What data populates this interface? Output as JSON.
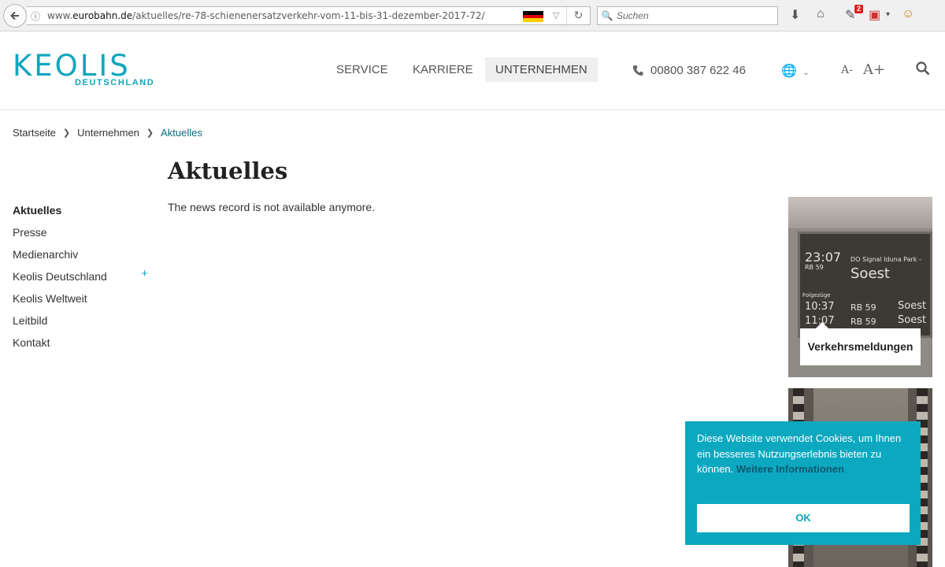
{
  "browser": {
    "url_prefix": "www.",
    "url_domain": "eurobahn.de",
    "url_path": "/aktuelles/re-78-schienenersatzverkehr-vom-11-bis-31-dezember-2017-72/",
    "search_placeholder": "Suchen",
    "notification_count": "2",
    "flag_colors": [
      "#000000",
      "#dd0000",
      "#ffce00"
    ]
  },
  "header": {
    "logo_word": "KEOLIS",
    "logo_sub": "DEUTSCHLAND",
    "nav": [
      "SERVICE",
      "KARRIERE",
      "UNTERNEHMEN"
    ],
    "phone": "00800 387 622 46",
    "font_smaller": "A-",
    "font_larger": "A+",
    "accent_color": "#0fa6bd"
  },
  "breadcrumb": [
    "Startseite",
    "Unternehmen",
    "Aktuelles"
  ],
  "main": {
    "title": "Aktuelles",
    "message": "The news record is not available anymore."
  },
  "sidebar": {
    "items": [
      "Aktuelles",
      "Presse",
      "Medienarchiv",
      "Keolis Deutschland",
      "Keolis Weltweit",
      "Leitbild",
      "Kontakt"
    ],
    "expand_symbol": "+"
  },
  "teaser": {
    "label": "Verkehrsmeldungen",
    "board": {
      "time": "23:07",
      "line": "RB 59",
      "via": "DO Signal Iduna Park -",
      "destination": "Soest",
      "next_label": "Folgezüge",
      "rows": [
        {
          "time": "10:37",
          "line": "RB 59",
          "dest": "Soest"
        },
        {
          "time": "11:07",
          "line": "RB 59",
          "dest": "Soest"
        }
      ]
    }
  },
  "cookie": {
    "text": "Diese Website verwendet Cookies, um Ihnen ein besseres Nutzungserlebnis bieten zu können.",
    "more": "Weitere Informationen",
    "ok": "OK"
  }
}
